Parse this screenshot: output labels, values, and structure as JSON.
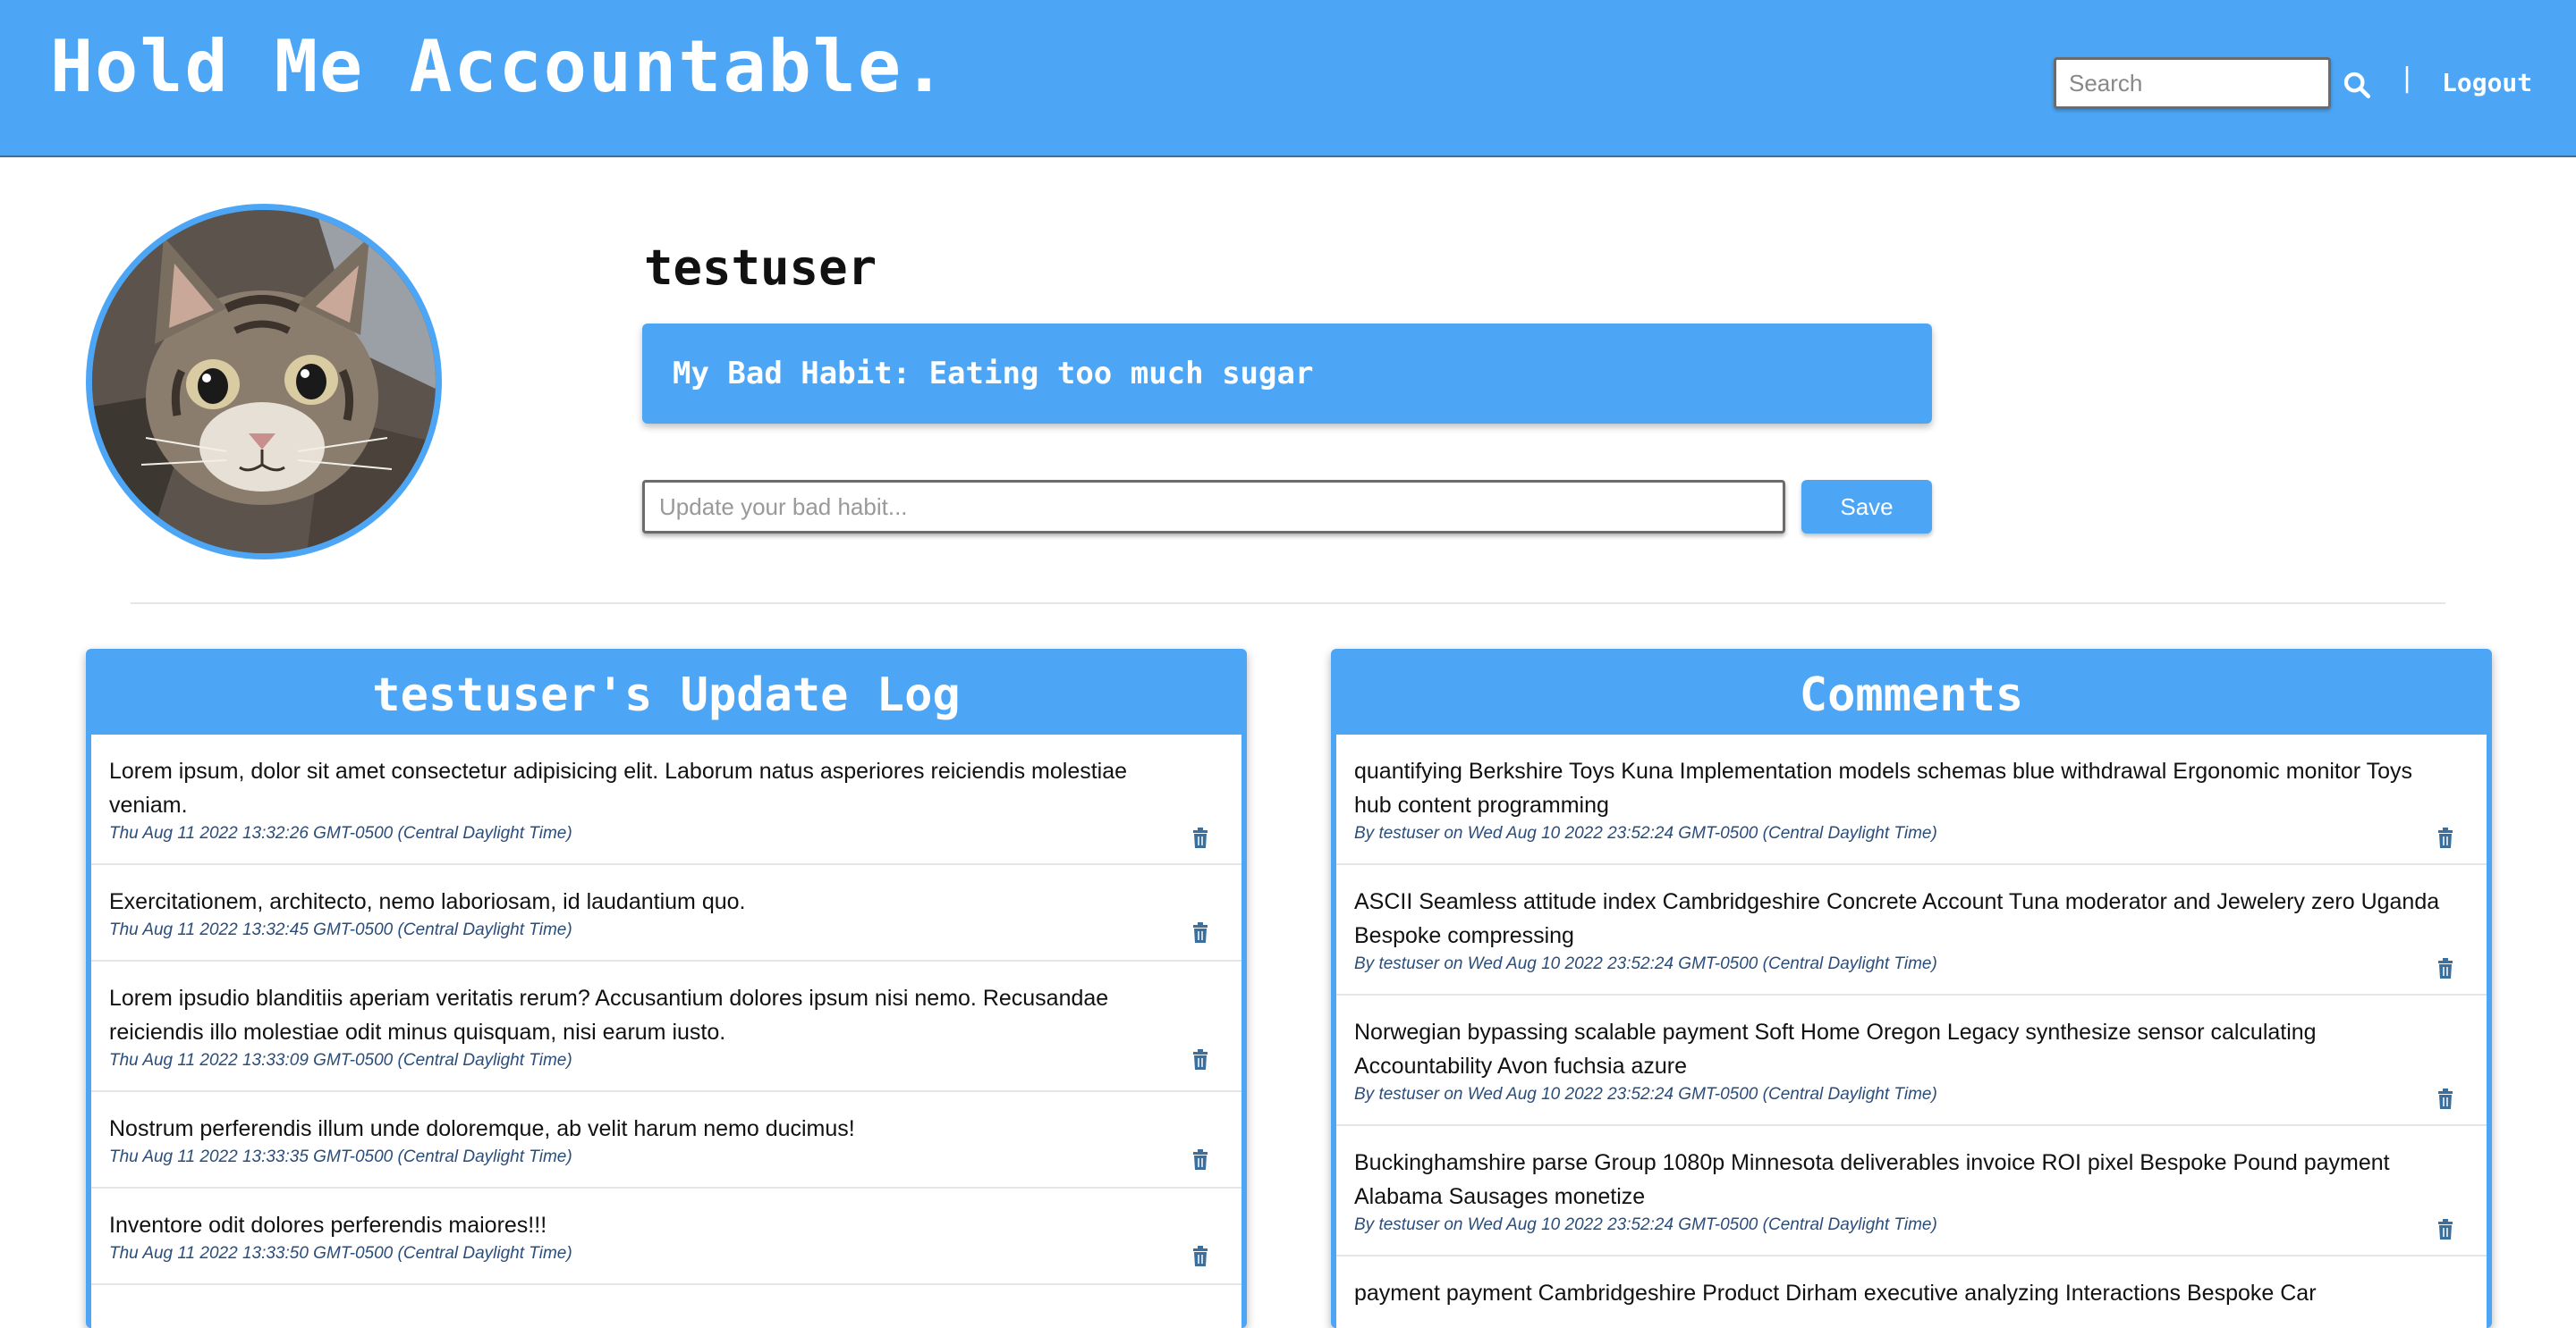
{
  "header": {
    "brand": "Hold Me Accountable.",
    "search_placeholder": "Search",
    "separator": "|",
    "logout_label": "Logout"
  },
  "profile": {
    "username": "testuser",
    "bad_habit": "My Bad Habit: Eating too much sugar",
    "update_placeholder": "Update your bad habit...",
    "save_label": "Save"
  },
  "update_log": {
    "title": "testuser's Update Log",
    "items": [
      {
        "text": "Lorem ipsum, dolor sit amet consectetur adipisicing elit. Laborum natus asperiores reiciendis molestiae veniam.",
        "date": "Thu Aug 11 2022 13:32:26 GMT-0500 (Central Daylight Time)"
      },
      {
        "text": "Exercitationem, architecto, nemo laboriosam, id laudantium quo.",
        "date": "Thu Aug 11 2022 13:32:45 GMT-0500 (Central Daylight Time)"
      },
      {
        "text": "Lorem ipsudio blanditiis aperiam veritatis rerum? Accusantium dolores ipsum nisi nemo. Recusandae reiciendis illo molestiae odit minus quisquam, nisi earum iusto.",
        "date": "Thu Aug 11 2022 13:33:09 GMT-0500 (Central Daylight Time)"
      },
      {
        "text": "Nostrum perferendis illum unde doloremque, ab velit harum nemo ducimus!",
        "date": "Thu Aug 11 2022 13:33:35 GMT-0500 (Central Daylight Time)"
      },
      {
        "text": "Inventore odit dolores perferendis maiores!!!",
        "date": "Thu Aug 11 2022 13:33:50 GMT-0500 (Central Daylight Time)"
      }
    ]
  },
  "comments": {
    "title": "Comments",
    "items": [
      {
        "text": "quantifying Berkshire Toys Kuna Implementation models schemas blue withdrawal Ergonomic monitor Toys hub content programming",
        "meta": "By testuser on Wed Aug 10 2022 23:52:24 GMT-0500 (Central Daylight Time)"
      },
      {
        "text": "ASCII Seamless attitude index Cambridgeshire Concrete Account Tuna moderator and Jewelery zero Uganda Bespoke compressing",
        "meta": "By testuser on Wed Aug 10 2022 23:52:24 GMT-0500 (Central Daylight Time)"
      },
      {
        "text": "Norwegian bypassing scalable payment Soft Home Oregon Legacy synthesize sensor calculating Accountability Avon fuchsia azure",
        "meta": "By testuser on Wed Aug 10 2022 23:52:24 GMT-0500 (Central Daylight Time)"
      },
      {
        "text": "Buckinghamshire parse Group 1080p Minnesota deliverables invoice ROI pixel Bespoke Pound payment Alabama Sausages monetize",
        "meta": "By testuser on Wed Aug 10 2022 23:52:24 GMT-0500 (Central Daylight Time)"
      },
      {
        "text": "payment payment Cambridgeshire Product Dirham executive analyzing Interactions Bespoke Car",
        "meta": ""
      }
    ]
  },
  "icons": {
    "search": "search-icon",
    "delete": "trash-icon",
    "avatar": "cat-photo"
  },
  "colors": {
    "primary": "#4da6f5",
    "meta_text": "#2a4d7a",
    "trash": "#3a6f9e"
  }
}
